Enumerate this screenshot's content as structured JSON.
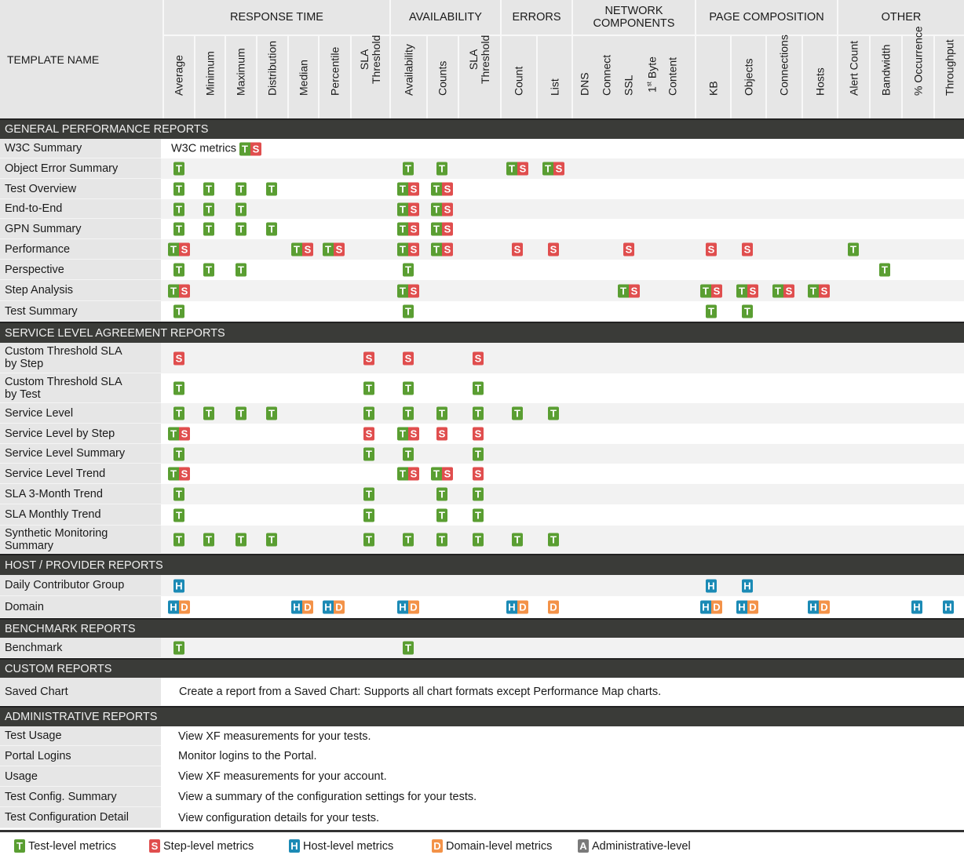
{
  "header": {
    "template_name_label": "TEMPLATE NAME",
    "groups": [
      {
        "label": "RESPONSE TIME",
        "span": [
          0,
          6
        ]
      },
      {
        "label": "AVAILABILITY",
        "span": [
          7,
          9
        ]
      },
      {
        "label": "ERRORS",
        "span": [
          10,
          11
        ]
      },
      {
        "label": "NETWORK COMPONENTS",
        "span": [
          12,
          16
        ]
      },
      {
        "label": "PAGE COMPOSITION",
        "span": [
          17,
          20
        ]
      },
      {
        "label": "OTHER",
        "span": [
          21,
          24
        ]
      }
    ],
    "columns": [
      {
        "label": "Average"
      },
      {
        "label": "Minimum"
      },
      {
        "label": "Maximum"
      },
      {
        "label": "Distribution"
      },
      {
        "label": "Median"
      },
      {
        "label": "Percentile"
      },
      {
        "label": "SLA\nThreshold"
      },
      {
        "label": "Availability"
      },
      {
        "label": "Counts"
      },
      {
        "label": "SLA\nThreshold"
      },
      {
        "label": "Count"
      },
      {
        "label": "List"
      },
      {
        "label": "DNS"
      },
      {
        "label": "Connect"
      },
      {
        "label": "SSL"
      },
      {
        "label": "1st Byte"
      },
      {
        "label": "Content"
      },
      {
        "label": "KB"
      },
      {
        "label": "Objects"
      },
      {
        "label": "Connections"
      },
      {
        "label": "Hosts"
      },
      {
        "label": "Alert Count"
      },
      {
        "label": "Bandwidth"
      },
      {
        "label": "% Occurrence"
      },
      {
        "label": "Throughput"
      }
    ]
  },
  "sections": [
    {
      "title": "GENERAL PERFORMANCE REPORTS",
      "rows": [
        {
          "name": "W3C Summary",
          "note": "W3C metrics",
          "note_badge": "TS"
        },
        {
          "name": "Object Error Summary",
          "cells": {
            "0": "T",
            "7": "T",
            "8": "T",
            "10": "TS",
            "11": "TS"
          }
        },
        {
          "name": "Test Overview",
          "cells": {
            "0": "T",
            "1": "T",
            "2": "T",
            "3": "T",
            "7": "TS",
            "8": "TS"
          }
        },
        {
          "name": "End-to-End",
          "cells": {
            "0": "T",
            "1": "T",
            "2": "T",
            "7": "TS",
            "8": "TS"
          }
        },
        {
          "name": "GPN Summary",
          "cells": {
            "0": "T",
            "1": "T",
            "2": "T",
            "3": "T",
            "7": "TS",
            "8": "TS"
          }
        },
        {
          "name": "Performance",
          "cells": {
            "0": "TS",
            "4": "TS",
            "5": "TS",
            "7": "TS",
            "8": "TS",
            "10": "S",
            "11": "S",
            "14": "S",
            "17": "S",
            "18": "S",
            "21": "T"
          }
        },
        {
          "name": "Perspective",
          "cells": {
            "0": "T",
            "1": "T",
            "2": "T",
            "7": "T",
            "22": "T"
          }
        },
        {
          "name": "Step Analysis",
          "cells": {
            "0": "TS",
            "7": "TS",
            "14": "TS",
            "17": "TS",
            "18": "TS",
            "19": "TS",
            "20": "TS"
          }
        },
        {
          "name": "Test Summary",
          "cells": {
            "0": "T",
            "7": "T",
            "17": "T",
            "18": "T"
          }
        }
      ]
    },
    {
      "title": "SERVICE LEVEL AGREEMENT REPORTS",
      "rows": [
        {
          "name": "Custom Threshold SLA by Step",
          "tall": true,
          "cells": {
            "0": "S",
            "6": "S",
            "7": "S",
            "9": "S"
          }
        },
        {
          "name": "Custom Threshold SLA by Test",
          "tall": true,
          "cells": {
            "0": "T",
            "6": "T",
            "7": "T",
            "9": "T"
          }
        },
        {
          "name": "Service Level",
          "cells": {
            "0": "T",
            "1": "T",
            "2": "T",
            "3": "T",
            "6": "T",
            "7": "T",
            "8": "T",
            "9": "T",
            "10": "T",
            "11": "T"
          }
        },
        {
          "name": "Service Level by Step",
          "cells": {
            "0": "TS",
            "6": "S",
            "7": "TS",
            "8": "S",
            "9": "S"
          }
        },
        {
          "name": "Service Level Summary",
          "cells": {
            "0": "T",
            "6": "T",
            "7": "T",
            "9": "T"
          }
        },
        {
          "name": "Service Level Trend",
          "cells": {
            "0": "TS",
            "7": "TS",
            "8": "TS",
            "9": "S"
          }
        },
        {
          "name": "SLA 3-Month Trend",
          "cells": {
            "0": "T",
            "6": "T",
            "8": "T",
            "9": "T"
          }
        },
        {
          "name": "SLA Monthly Trend",
          "cells": {
            "0": "T",
            "6": "T",
            "8": "T",
            "9": "T"
          }
        },
        {
          "name": "Synthetic Monitoring Summary",
          "tall": true,
          "cells": {
            "0": "T",
            "1": "T",
            "2": "T",
            "3": "T",
            "6": "T",
            "7": "T",
            "8": "T",
            "9": "T",
            "10": "T",
            "11": "T"
          }
        }
      ]
    },
    {
      "title": "HOST / PROVIDER REPORTS",
      "rows": [
        {
          "name": "Daily Contributor Group",
          "cells": {
            "0": "H",
            "17": "H",
            "18": "H"
          }
        },
        {
          "name": "Domain",
          "cells": {
            "0": "HD",
            "4": "HD",
            "5": "HD",
            "7": "HD",
            "10": "HD",
            "11": "D",
            "17": "HD",
            "18": "HD",
            "20": "HD",
            "23": "H",
            "24": "H"
          }
        }
      ]
    },
    {
      "title": "BENCHMARK REPORTS",
      "rows": [
        {
          "name": "Benchmark",
          "cells": {
            "0": "T",
            "7": "T"
          }
        }
      ]
    },
    {
      "title": "CUSTOM REPORTS",
      "rows": [
        {
          "name": "Saved Chart",
          "desc": "Create a report from a Saved Chart: Supports all chart formats except Performance Map charts."
        }
      ]
    },
    {
      "title": "ADMINISTRATIVE REPORTS",
      "rows": [
        {
          "name": "Test Usage",
          "desc": "View XF measurements for your tests."
        },
        {
          "name": "Portal Logins",
          "desc": "Monitor logins to the Portal."
        },
        {
          "name": "Usage",
          "desc": "View XF measurements for your account."
        },
        {
          "name": "Test Config. Summary",
          "desc": "View a summary of the configuration settings for your tests."
        },
        {
          "name": "Test Configuration Detail",
          "desc": "View configuration details for your tests."
        }
      ]
    }
  ],
  "legend": [
    {
      "badge": "T",
      "label": "Test-level metrics"
    },
    {
      "badge": "S",
      "label": "Step-level metrics"
    },
    {
      "badge": "H",
      "label": "Host-level metrics"
    },
    {
      "badge": "D",
      "label": "Domain-level metrics"
    },
    {
      "badge": "A",
      "label": "Administrative-level"
    }
  ],
  "colors": {
    "test": "#5a9e32",
    "step": "#e04e4e",
    "host": "#1b8ab5",
    "domain": "#f39248",
    "admin": "#7a7a7a",
    "section_bar": "#3a3b38",
    "header_bg": "#e6e6e6"
  }
}
